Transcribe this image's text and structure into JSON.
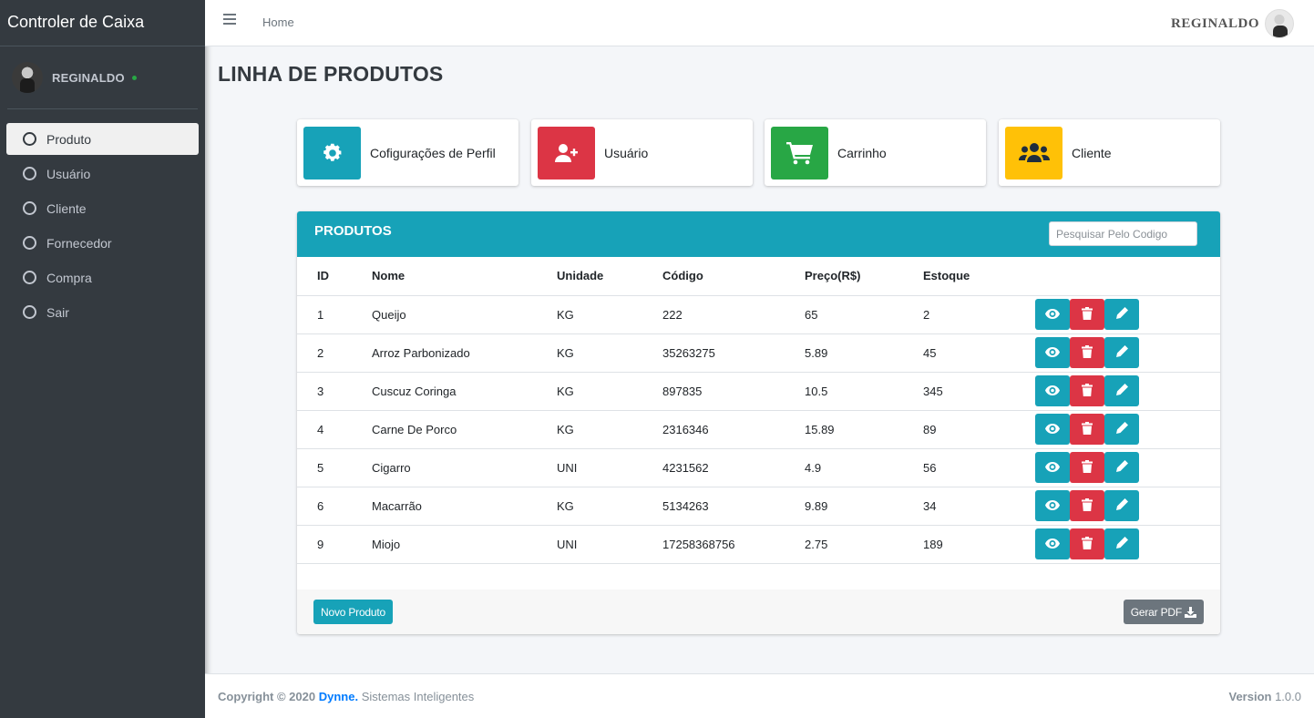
{
  "app": {
    "brand": "Controler de Caixa"
  },
  "user": {
    "name": "REGINALDO"
  },
  "sidebar": {
    "items": [
      {
        "label": "Produto"
      },
      {
        "label": "Usuário"
      },
      {
        "label": "Cliente"
      },
      {
        "label": "Fornecedor"
      },
      {
        "label": "Compra"
      },
      {
        "label": "Sair"
      }
    ]
  },
  "topbar": {
    "home": "Home",
    "user_name": "REGINALDO"
  },
  "page": {
    "title": "LINHA DE PRODUTOS"
  },
  "info_boxes": [
    {
      "label": "Cofigurações de Perfil",
      "icon": "gear-icon",
      "color": "#17a2b8"
    },
    {
      "label": "Usuário",
      "icon": "user-plus-icon",
      "color": "#dc3545"
    },
    {
      "label": "Carrinho",
      "icon": "cart-icon",
      "color": "#28a745"
    },
    {
      "label": "Cliente",
      "icon": "users-icon",
      "color": "#ffc107"
    }
  ],
  "products": {
    "title": "PRODUTOS",
    "search_placeholder": "Pesquisar Pelo Codigo",
    "columns": [
      "ID",
      "Nome",
      "Unidade",
      "Código",
      "Preço(R$)",
      "Estoque"
    ],
    "rows": [
      {
        "id": "1",
        "nome": "Queijo",
        "unidade": "KG",
        "codigo": "222",
        "preco": "65",
        "estoque": "2"
      },
      {
        "id": "2",
        "nome": "Arroz Parbonizado",
        "unidade": "KG",
        "codigo": "35263275",
        "preco": "5.89",
        "estoque": "45"
      },
      {
        "id": "3",
        "nome": "Cuscuz Coringa",
        "unidade": "KG",
        "codigo": "897835",
        "preco": "10.5",
        "estoque": "345"
      },
      {
        "id": "4",
        "nome": "Carne De Porco",
        "unidade": "KG",
        "codigo": "2316346",
        "preco": "15.89",
        "estoque": "89"
      },
      {
        "id": "5",
        "nome": "Cigarro",
        "unidade": "UNI",
        "codigo": "4231562",
        "preco": "4.9",
        "estoque": "56"
      },
      {
        "id": "6",
        "nome": "Macarrão",
        "unidade": "KG",
        "codigo": "5134263",
        "preco": "9.89",
        "estoque": "34"
      },
      {
        "id": "9",
        "nome": "Miojo",
        "unidade": "UNI",
        "codigo": "17258368756",
        "preco": "2.75",
        "estoque": "189"
      }
    ],
    "new_button": "Novo Produto",
    "pdf_button": "Gerar PDF"
  },
  "footer": {
    "copyright": "Copyright © 2020",
    "company": "Dynne.",
    "tagline": "Sistemas Inteligentes",
    "version_label": "Version",
    "version": "1.0.0"
  },
  "colors": {
    "sidebar": "#343a40",
    "info": "#17a2b8",
    "danger": "#dc3545",
    "success": "#28a745",
    "warning": "#ffc107",
    "secondary": "#6c757d"
  }
}
